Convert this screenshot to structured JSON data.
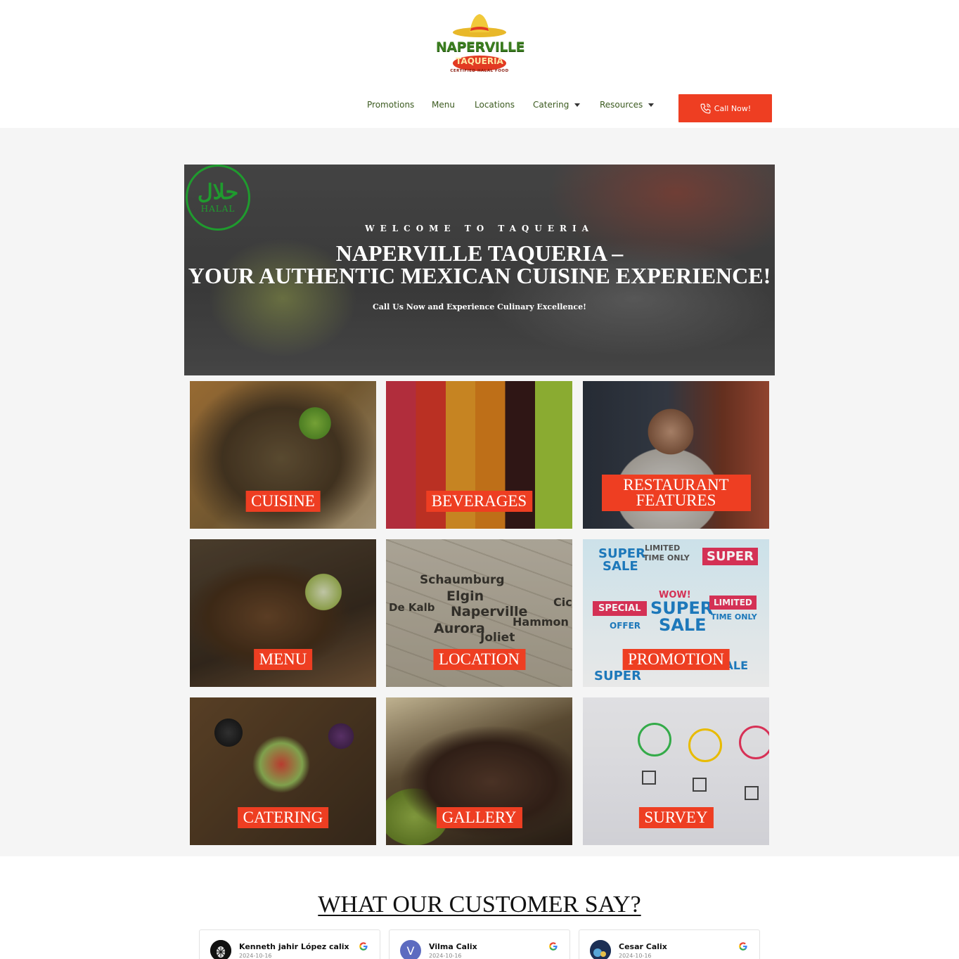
{
  "brand": {
    "logo_word_1": "NAPERVILLE",
    "logo_word_2": "TAQUERIA",
    "logo_tagline": "CERTIFIED HALAL FOOD",
    "accent_color": "#ee3e22",
    "nav_text_color": "#3b5a1f"
  },
  "nav": {
    "items": [
      {
        "label": "Promotions",
        "dropdown": false
      },
      {
        "label": "Menu",
        "dropdown": false
      },
      {
        "label": "Locations",
        "dropdown": false
      },
      {
        "label": "Catering",
        "dropdown": true
      },
      {
        "label": "Resources",
        "dropdown": true
      }
    ],
    "call_button": "Call Now!",
    "call_icon": "phone-icon"
  },
  "hero": {
    "badge_arabic": "حلال",
    "badge_text": "HALAL",
    "eyebrow": "WELCOME TO TAQUERIA",
    "title_line_1": "NAPERVILLE TAQUERIA –",
    "title_line_2": "YOUR AUTHENTIC MEXICAN CUISINE EXPERIENCE!",
    "subtitle": "Call Us Now and Experience Culinary Excellence!"
  },
  "tiles": [
    {
      "label": "CUISINE"
    },
    {
      "label": "BEVERAGES"
    },
    {
      "label": "RESTAURANT FEATURES"
    },
    {
      "label": "MENU"
    },
    {
      "label": "LOCATION"
    },
    {
      "label": "PROMOTION"
    },
    {
      "label": "CATERING"
    },
    {
      "label": "GALLERY"
    },
    {
      "label": "SURVEY"
    }
  ],
  "map_words": [
    "Schaumburg",
    "Elgin",
    "De Kalb",
    "Naperville",
    "Aurora",
    "Joliet",
    "Hammon",
    "Cic"
  ],
  "promo_words": {
    "wow": "WOW!",
    "super": "SUPER",
    "sale": "SALE",
    "limited": "LIMITED",
    "time_only": "TIME ONLY",
    "special": "SPECIAL",
    "offer": "OFFER"
  },
  "testimonials": {
    "title": "WHAT OUR CUSTOMER SAY?",
    "reviews": [
      {
        "name": "Kenneth jahir López calix",
        "date": "2024-10-16",
        "avatar_letter": "",
        "avatar_color": "#111111"
      },
      {
        "name": "Vilma Calix",
        "date": "2024-10-16",
        "avatar_letter": "V",
        "avatar_color": "#5c6bc0"
      },
      {
        "name": "Cesar Calix",
        "date": "2024-10-16",
        "avatar_letter": "",
        "avatar_color": "#2a4a7a"
      }
    ]
  }
}
